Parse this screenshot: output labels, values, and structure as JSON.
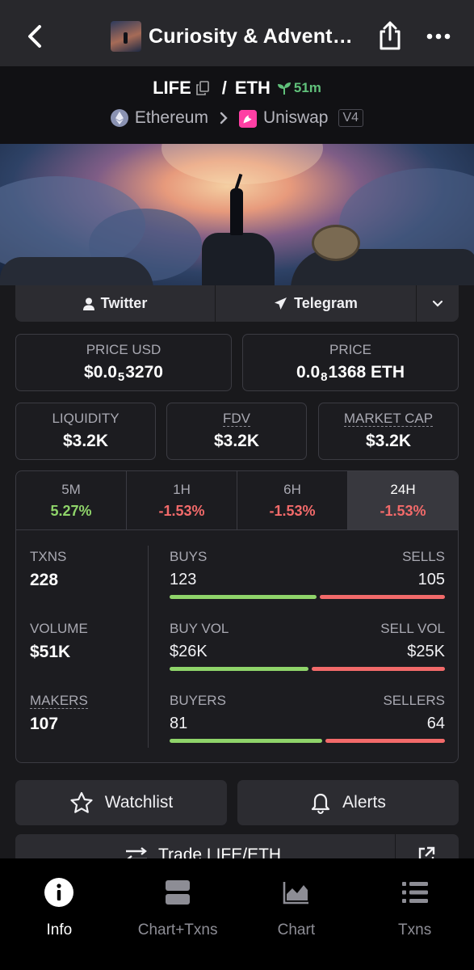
{
  "header": {
    "title": "Curiosity & Advent…",
    "back_icon": "chevron-left-icon",
    "share_icon": "share-icon",
    "more_icon": "more-horizontal-icon"
  },
  "pair": {
    "base": "LIFE",
    "quote": "ETH",
    "separator": "/",
    "age": "51m",
    "chain": "Ethereum",
    "dex": "Uniswap",
    "dex_version": "V4"
  },
  "social": {
    "twitter": "Twitter",
    "telegram": "Telegram"
  },
  "prices": {
    "usd_label": "PRICE USD",
    "usd_prefix": "$0.0",
    "usd_zeros": "5",
    "usd_digits": "3270",
    "native_label": "PRICE",
    "native_prefix": "0.0",
    "native_zeros": "8",
    "native_digits": "1368 ETH"
  },
  "metrics": {
    "liquidity_label": "LIQUIDITY",
    "liquidity_value": "$3.2K",
    "fdv_label": "FDV",
    "fdv_value": "$3.2K",
    "mcap_label": "MARKET CAP",
    "mcap_value": "$3.2K"
  },
  "timeframes": [
    {
      "label": "5M",
      "change": "5.27%",
      "direction": "up"
    },
    {
      "label": "1H",
      "change": "-1.53%",
      "direction": "down"
    },
    {
      "label": "6H",
      "change": "-1.53%",
      "direction": "down"
    },
    {
      "label": "24H",
      "change": "-1.53%",
      "direction": "down",
      "selected": true
    }
  ],
  "stats": {
    "txns_label": "TXNS",
    "txns_value": "228",
    "buys_label": "BUYS",
    "buys_value": "123",
    "sells_label": "SELLS",
    "sells_value": "105",
    "volume_label": "VOLUME",
    "volume_value": "$51K",
    "buy_vol_label": "BUY VOL",
    "buy_vol_value": "$26K",
    "sell_vol_label": "SELL VOL",
    "sell_vol_value": "$25K",
    "makers_label": "MAKERS",
    "makers_value": "107",
    "buyers_label": "BUYERS",
    "buyers_value": "81",
    "sellers_label": "SELLERS",
    "sellers_value": "64",
    "buy_ratio_txns": 0.54,
    "buy_ratio_volume": 0.51,
    "buy_ratio_makers": 0.56
  },
  "actions": {
    "watchlist": "Watchlist",
    "alerts": "Alerts",
    "trade": "Trade LIFE/ETH"
  },
  "nav": [
    {
      "label": "Info",
      "icon": "info-icon",
      "active": true
    },
    {
      "label": "Chart+Txns",
      "icon": "split-layout-icon"
    },
    {
      "label": "Chart",
      "icon": "area-chart-icon"
    },
    {
      "label": "Txns",
      "icon": "list-icon"
    }
  ],
  "colors": {
    "positive": "#8fd46a",
    "negative": "#f26a6a",
    "age_green": "#60c07a",
    "background": "#19191c"
  }
}
